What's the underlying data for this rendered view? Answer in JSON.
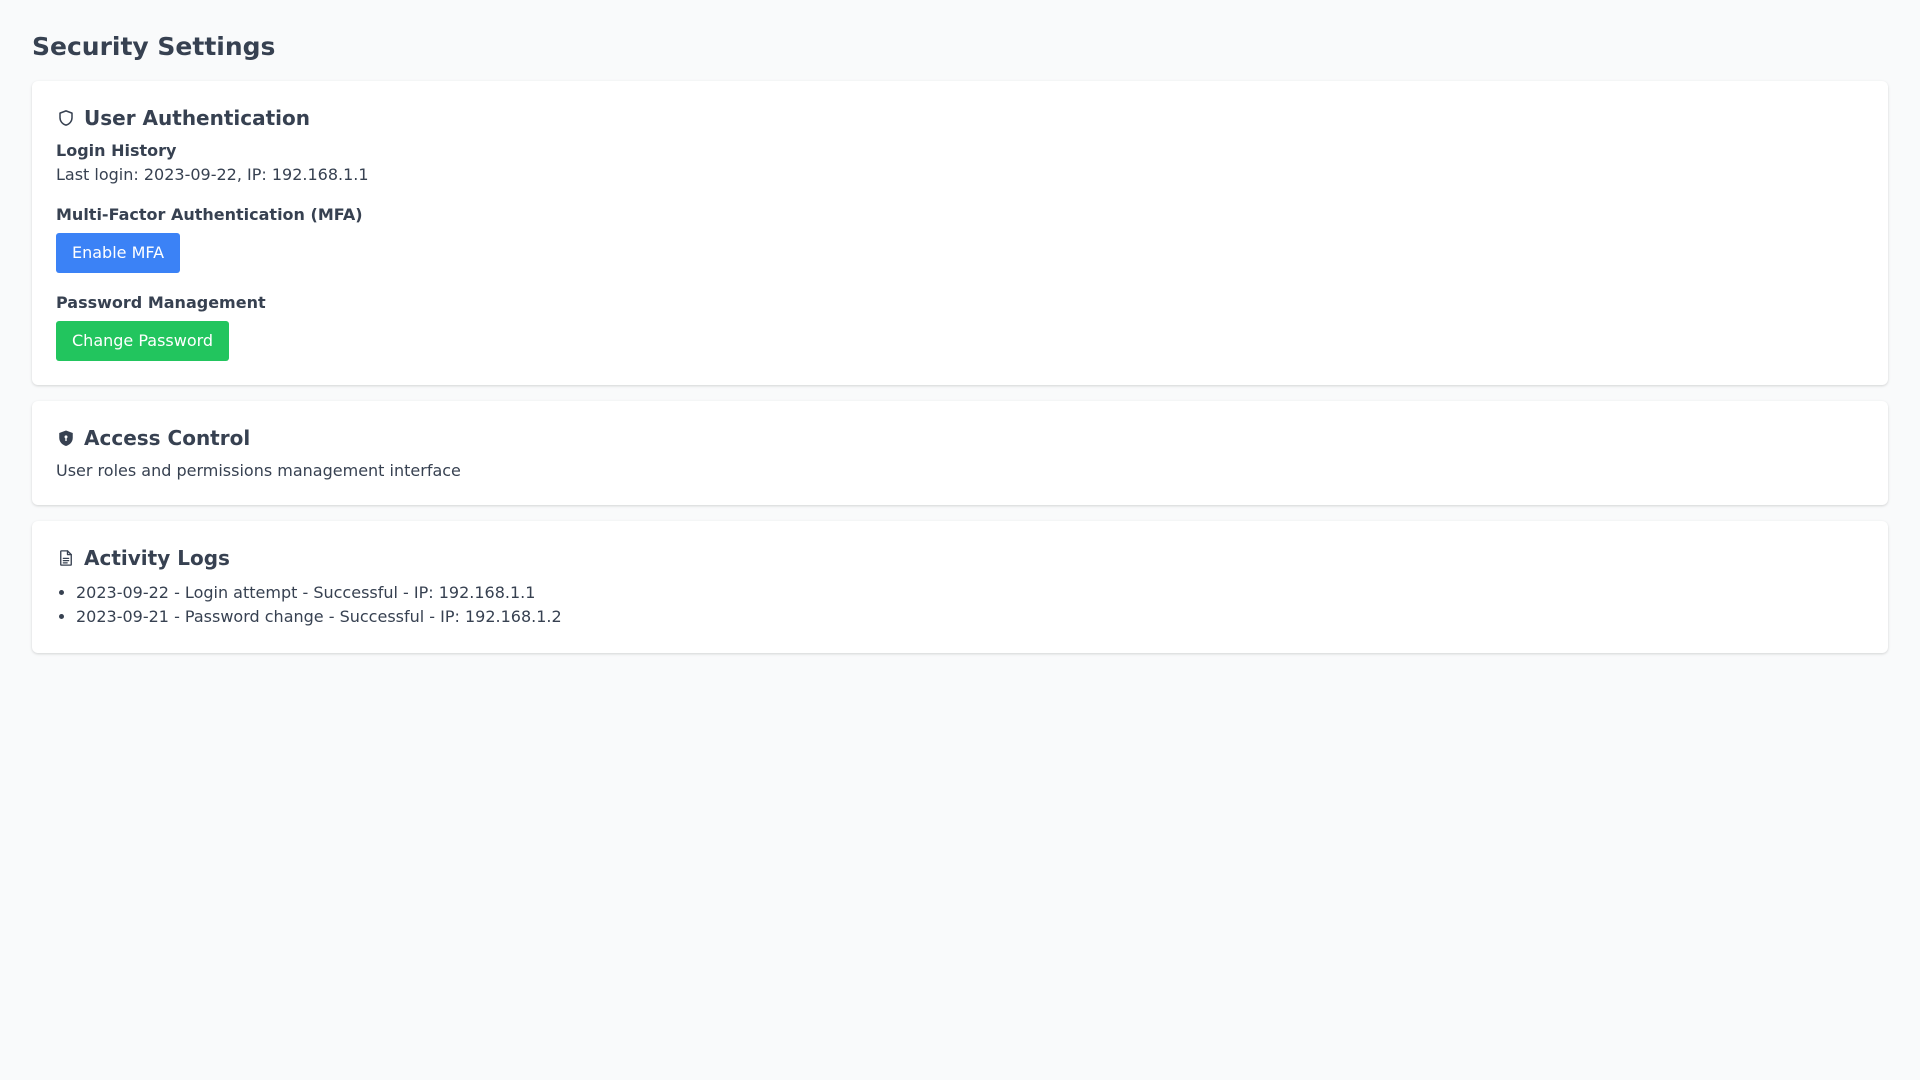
{
  "page": {
    "title": "Security Settings"
  },
  "user_authentication": {
    "title": "User Authentication",
    "icon": "shield-outline-icon",
    "login_history": {
      "label": "Login History",
      "value": "Last login: 2023-09-22, IP: 192.168.1.1"
    },
    "mfa": {
      "label": "Multi-Factor Authentication (MFA)",
      "button_label": "Enable MFA"
    },
    "password": {
      "label": "Password Management",
      "button_label": "Change Password"
    }
  },
  "access_control": {
    "title": "Access Control",
    "icon": "shield-lock-icon",
    "description": "User roles and permissions management interface"
  },
  "activity_logs": {
    "title": "Activity Logs",
    "icon": "document-icon",
    "items": [
      "2023-09-22 - Login attempt - Successful - IP: 192.168.1.1",
      "2023-09-21 - Password change - Successful - IP: 192.168.1.2"
    ]
  },
  "colors": {
    "background": "#f9fafb",
    "text": "#374151",
    "primary_button": "#3b82f6",
    "success_button": "#22c55e"
  }
}
